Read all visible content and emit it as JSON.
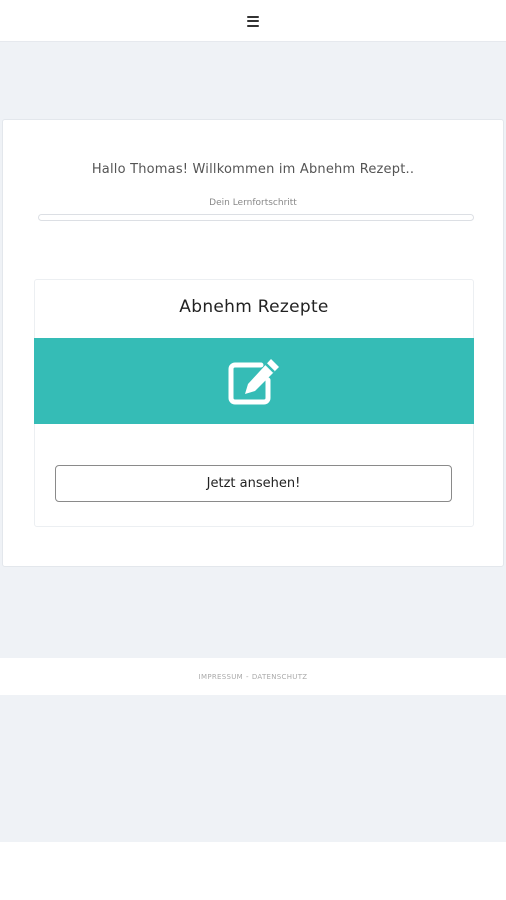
{
  "header": {
    "menu_icon": "hamburger-menu-icon"
  },
  "welcome": {
    "greeting": "Hallo Thomas! Willkommen im Abnehm Rezept..",
    "progress_label": "Dein Lernfortschritt",
    "progress": 0
  },
  "course": {
    "title": "Abnehm Rezepte",
    "icon": "edit-icon",
    "banner_color": "#35bcb6",
    "button_label": "Jetzt ansehen!"
  },
  "footer": {
    "impressum": "IMPRESSUM",
    "separator": "-",
    "datenschutz": "DATENSCHUTZ"
  }
}
